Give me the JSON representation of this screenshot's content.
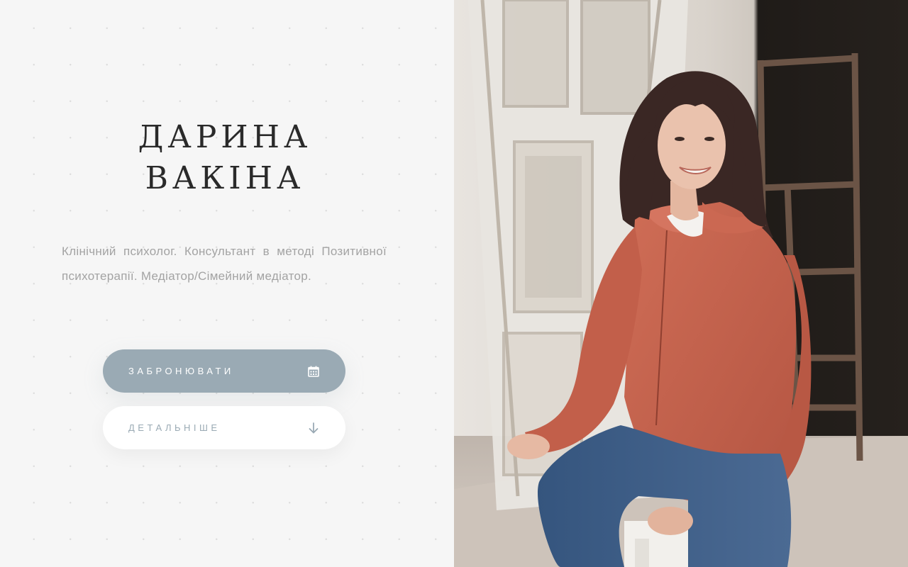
{
  "hero": {
    "name_line1": "ДАРИНА",
    "name_line2": "ВАКІНА",
    "description": "Клінічний психолог. Консультант в методі Позитивної психотерапії. Медіатор/Сімейний медіатор."
  },
  "buttons": {
    "book_label": "ЗАБРОНЮВАТИ",
    "book_icon": "calendar-icon",
    "more_label": "ДЕТАЛЬНІШЕ",
    "more_icon": "arrow-down-icon"
  },
  "colors": {
    "accent": "#9aaab4",
    "background": "#f6f6f6",
    "heading": "#2a2a2a",
    "body_text": "#a3a3a3",
    "sweater": "#c4634e"
  }
}
